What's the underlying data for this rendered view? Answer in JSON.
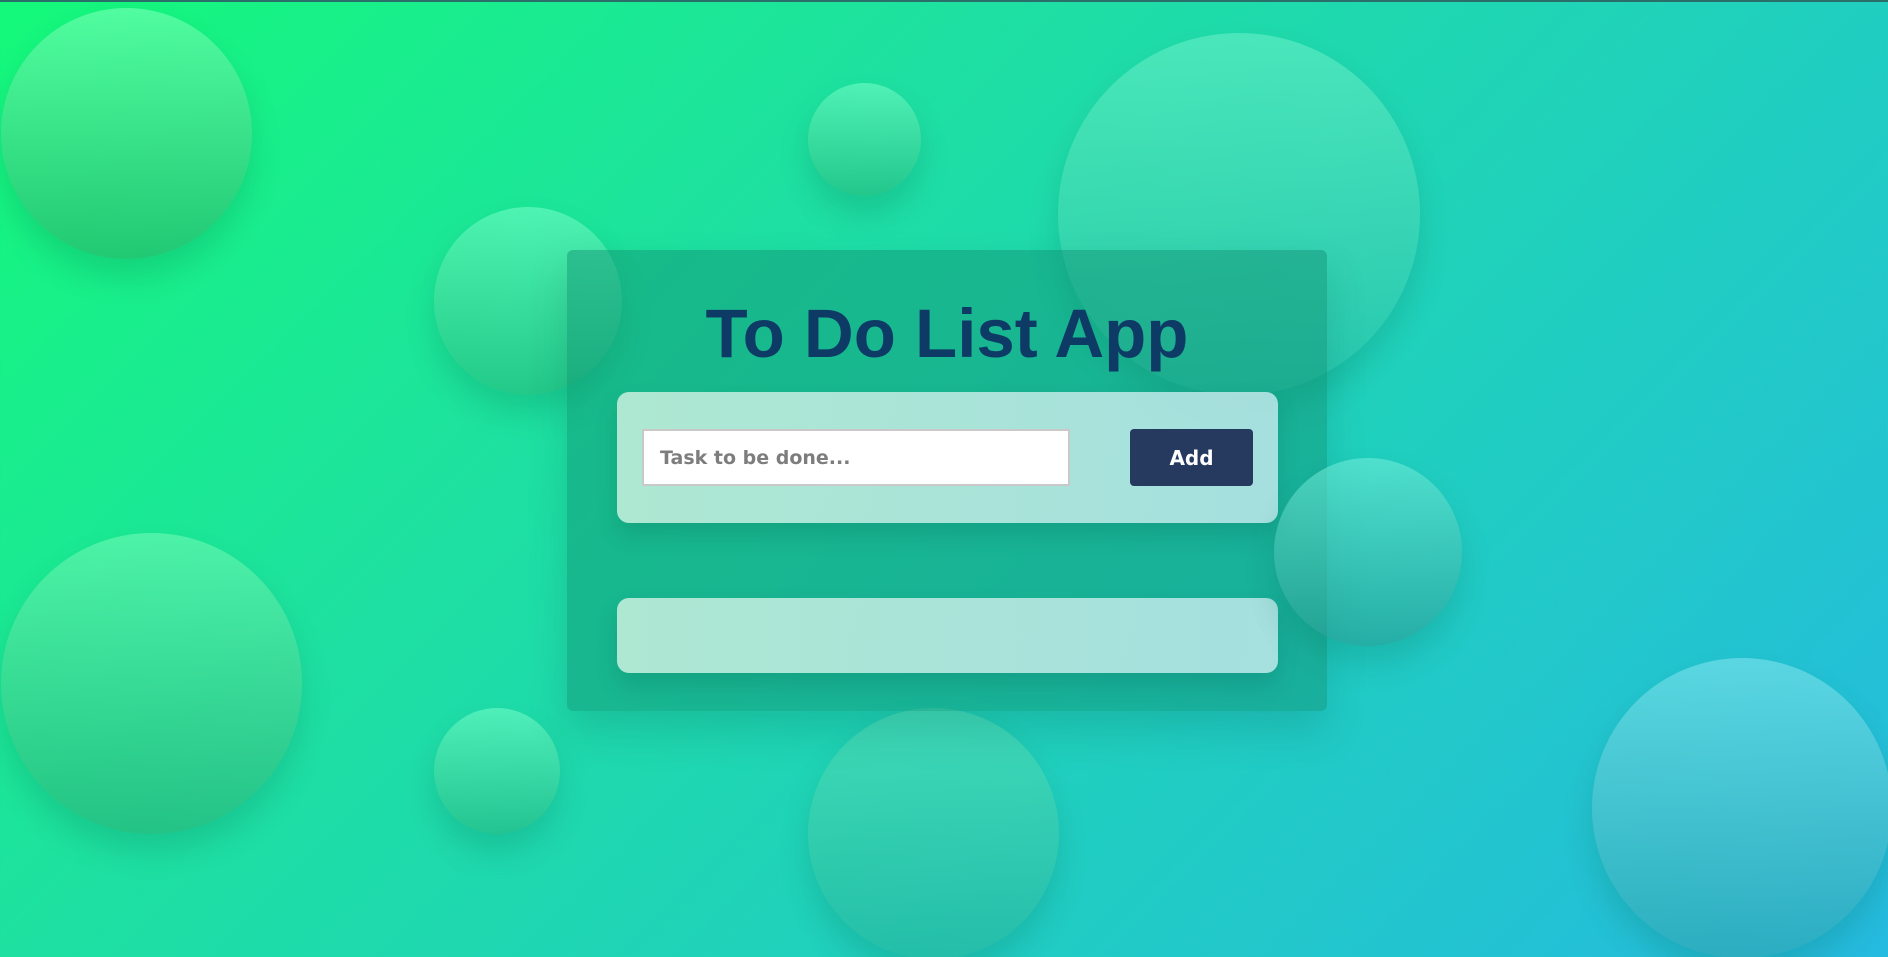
{
  "app": {
    "title": "To Do List App"
  },
  "task_input": {
    "value": "",
    "placeholder": "Task to be done..."
  },
  "add_button": {
    "label": "Add"
  },
  "task_list": {
    "items": []
  },
  "colors": {
    "title": "#0e3a66",
    "button_bg": "#253a5e",
    "button_text": "#ffffff",
    "background_start": "#14f97a",
    "background_end": "#25bae0"
  }
}
